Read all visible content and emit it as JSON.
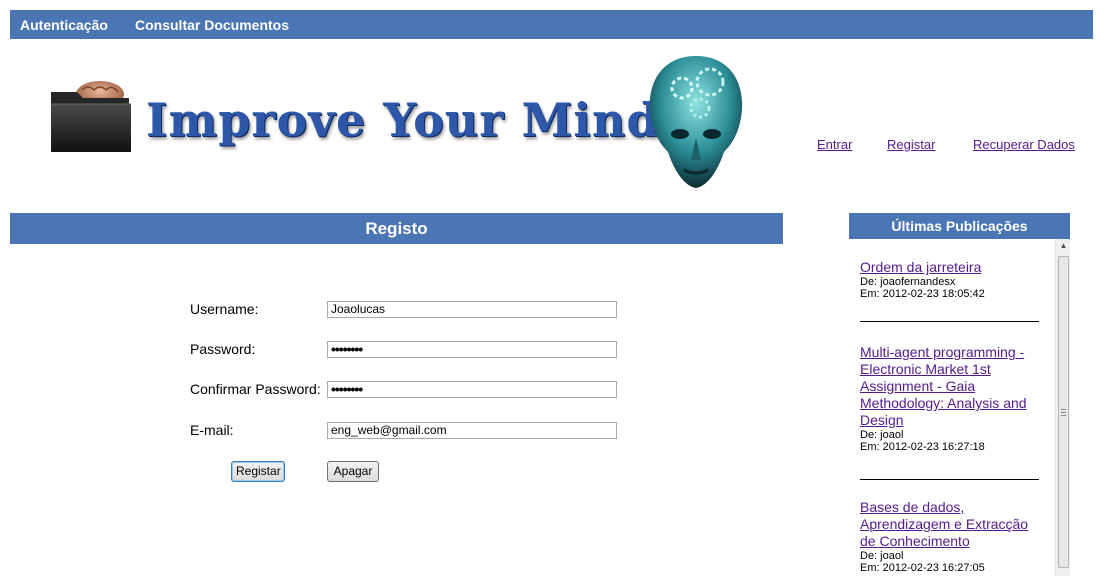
{
  "nav": {
    "autenticacao": "Autenticação",
    "consultar": "Consultar Documentos"
  },
  "logo": {
    "text": "Improve Your Mind"
  },
  "auth_links": {
    "entrar": "Entrar",
    "registar": "Registar",
    "recuperar": "Recuperar Dados"
  },
  "register": {
    "title": "Registo",
    "username_label": "Username:",
    "username_value": "Joaolucas",
    "password_label": "Password:",
    "password_value": "••••••••",
    "confirm_label": "Confirmar Password:",
    "confirm_value": "••••••••",
    "email_label": "E-mail:",
    "email_value": "eng_web@gmail.com",
    "submit_label": "Registar",
    "clear_label": "Apagar"
  },
  "sidebar": {
    "title": "Últimas Publicações",
    "pubs": [
      {
        "title": "Ordem da jarreteira",
        "author": "De: joaofernandesx",
        "date": "Em: 2012-02-23 18:05:42"
      },
      {
        "title": "Multi-agent programming - Electronic Market 1st Assignment - Gaia Methodology: Analysis and Design",
        "author": "De: joaol",
        "date": "Em: 2012-02-23 16:27:18"
      },
      {
        "title": "Bases de dados, Aprendizagem e Extracção de Conhecimento",
        "author": "De: joaol",
        "date": "Em: 2012-02-23 16:27:05"
      }
    ]
  },
  "colors": {
    "bar": "#4b76b4",
    "link": "#551a8b",
    "logo_text": "#2d57a8"
  }
}
